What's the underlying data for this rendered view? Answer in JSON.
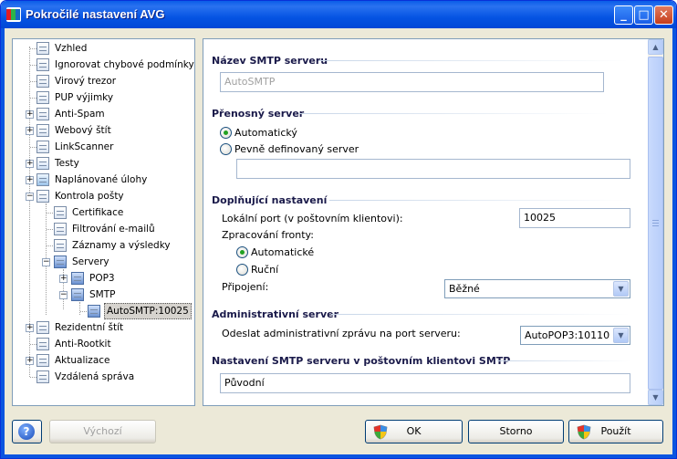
{
  "window": {
    "title": "Pokročilé nastavení AVG"
  },
  "tree": {
    "items": [
      {
        "label": "Vzhled"
      },
      {
        "label": "Ignorovat chybové podmínky"
      },
      {
        "label": "Virový trezor"
      },
      {
        "label": "PUP výjimky"
      },
      {
        "label": "Anti-Spam"
      },
      {
        "label": "Webový štít"
      },
      {
        "label": "LinkScanner"
      },
      {
        "label": "Testy"
      },
      {
        "label": "Naplánované úlohy"
      },
      {
        "label": "Kontrola pošty"
      },
      {
        "label": "Certifikace"
      },
      {
        "label": "Filtrování e-mailů"
      },
      {
        "label": "Záznamy a výsledky"
      },
      {
        "label": "Servery"
      },
      {
        "label": "POP3"
      },
      {
        "label": "SMTP"
      },
      {
        "label": "AutoSMTP:10025"
      },
      {
        "label": "Rezidentní štít"
      },
      {
        "label": "Anti-Rootkit"
      },
      {
        "label": "Aktualizace"
      },
      {
        "label": "Vzdálená správa"
      }
    ]
  },
  "settings": {
    "server_name": {
      "title": "Název SMTP serveru",
      "value": "AutoSMTP"
    },
    "transfer": {
      "title": "Přenosný server",
      "option_auto": "Automatický",
      "option_fixed": "Pevně definovaný server",
      "fixed_value": ""
    },
    "additional": {
      "title": "Doplňující nastavení",
      "local_port_label": "Lokální port (v poštovním klientovi):",
      "local_port_value": "10025",
      "queue_label": "Zpracování fronty:",
      "queue_auto": "Automatické",
      "queue_manual": "Ruční",
      "connection_label": "Připojení:",
      "connection_value": "Běžné"
    },
    "admin": {
      "title": "Administrativní server",
      "send_label": "Odeslat administrativní zprávu na port serveru:",
      "send_value": "AutoPOP3:10110"
    },
    "client": {
      "title": "Nastavení SMTP serveru v poštovním klientovi SMTP",
      "value": "Původní"
    }
  },
  "buttons": {
    "default": "Výchozí",
    "ok": "OK",
    "cancel": "Storno",
    "apply": "Použít"
  }
}
